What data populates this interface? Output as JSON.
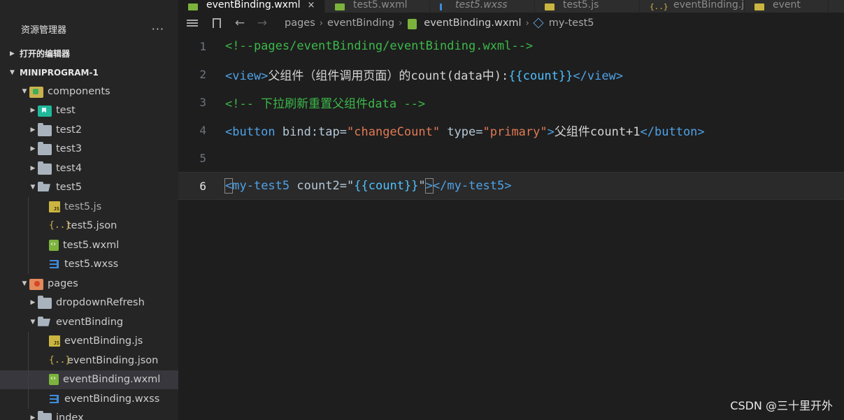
{
  "sidebar": {
    "title": "资源管理器",
    "more_label": "···",
    "sections": {
      "open_editors": "打开的编辑器",
      "project": "MINIPROGRAM-1"
    },
    "tree": [
      {
        "label": "components",
        "kind": "folder-components",
        "level": 1,
        "expanded": true
      },
      {
        "label": "test",
        "kind": "folder-cyan",
        "level": 2,
        "expanded": false
      },
      {
        "label": "test2",
        "kind": "folder",
        "level": 2,
        "expanded": false
      },
      {
        "label": "test3",
        "kind": "folder",
        "level": 2,
        "expanded": false
      },
      {
        "label": "test4",
        "kind": "folder",
        "level": 2,
        "expanded": false
      },
      {
        "label": "test5",
        "kind": "folder",
        "level": 2,
        "expanded": true
      },
      {
        "label": "test5.js",
        "kind": "js",
        "level": 3,
        "dim": true
      },
      {
        "label": "test5.json",
        "kind": "json",
        "level": 3
      },
      {
        "label": "test5.wxml",
        "kind": "wxml",
        "level": 3
      },
      {
        "label": "test5.wxss",
        "kind": "wxss",
        "level": 3
      },
      {
        "label": "pages",
        "kind": "folder-pages",
        "level": 1,
        "expanded": true
      },
      {
        "label": "dropdownRefresh",
        "kind": "folder",
        "level": 2,
        "expanded": false
      },
      {
        "label": "eventBinding",
        "kind": "folder",
        "level": 2,
        "expanded": true
      },
      {
        "label": "eventBinding.js",
        "kind": "js",
        "level": 3
      },
      {
        "label": "eventBinding.json",
        "kind": "json",
        "level": 3
      },
      {
        "label": "eventBinding.wxml",
        "kind": "wxml",
        "level": 3,
        "selected": true
      },
      {
        "label": "eventBinding.wxss",
        "kind": "wxss",
        "level": 3
      },
      {
        "label": "index",
        "kind": "folder",
        "level": 2,
        "expanded": false
      }
    ]
  },
  "tabs": [
    {
      "label": "eventBinding.wxml",
      "icon": "wxml",
      "active": true,
      "close": "×"
    },
    {
      "label": "test5.wxml",
      "icon": "wxml"
    },
    {
      "label": "test5.wxss",
      "icon": "wxss",
      "italic": true
    },
    {
      "label": "test5.js",
      "icon": "js"
    },
    {
      "label": "eventBinding.json",
      "icon": "json"
    },
    {
      "label": "event",
      "icon": "js"
    }
  ],
  "breadcrumb": [
    "pages",
    "eventBinding",
    "eventBinding.wxml",
    "my-test5"
  ],
  "code_lines": [
    {
      "number": "1",
      "tokens": [
        {
          "t": "<!--pages/eventBinding/eventBinding.wxml-->",
          "c": "comment"
        }
      ]
    },
    {
      "number": "2",
      "tokens": [
        {
          "t": "<view>",
          "c": "tag"
        },
        {
          "t": "父组件（组件调用页面）的count(data中):",
          "c": "text"
        },
        {
          "t": "{{count}}",
          "c": "mustache"
        },
        {
          "t": "</view>",
          "c": "tag"
        }
      ]
    },
    {
      "number": "3",
      "tokens": [
        {
          "t": "<!-- 下拉刷新重置父组件data -->",
          "c": "comment"
        }
      ]
    },
    {
      "number": "4",
      "tokens": [
        {
          "t": "<button",
          "c": "tag"
        },
        {
          "t": " bind:tap=",
          "c": "attr"
        },
        {
          "t": "\"changeCount\"",
          "c": "str"
        },
        {
          "t": " type=",
          "c": "attr"
        },
        {
          "t": "\"primary\"",
          "c": "str"
        },
        {
          "t": ">",
          "c": "tag"
        },
        {
          "t": "父组件count+1",
          "c": "text"
        },
        {
          "t": "</button>",
          "c": "tag"
        }
      ]
    },
    {
      "number": "5",
      "tokens": []
    },
    {
      "number": "6",
      "current": true,
      "tokens": [
        {
          "t": "<",
          "c": "tag",
          "box": true
        },
        {
          "t": "my-test5",
          "c": "tag"
        },
        {
          "t": " count2=",
          "c": "attr"
        },
        {
          "t": "\"",
          "c": "attr"
        },
        {
          "t": "{{count}}",
          "c": "mustache"
        },
        {
          "t": "\"",
          "c": "attr"
        },
        {
          "t": ">",
          "c": "tag",
          "box": true
        },
        {
          "t": "</my-test5>",
          "c": "tag"
        }
      ]
    }
  ],
  "watermark": "CSDN @三十里开外"
}
